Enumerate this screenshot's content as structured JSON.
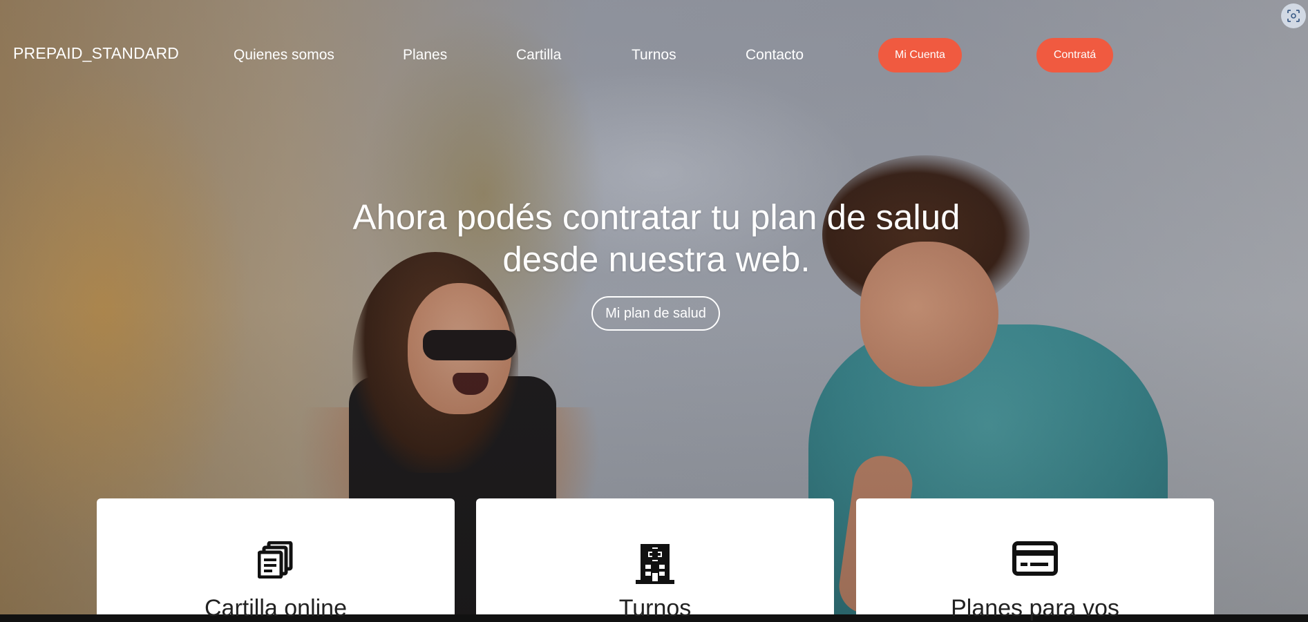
{
  "nav": {
    "brand": "PREPAID_STANDARD",
    "links": [
      "Quienes somos",
      "Planes",
      "Cartilla",
      "Turnos",
      "Contacto"
    ],
    "account_button": "Mi Cuenta",
    "contract_button": "Contratá"
  },
  "hero": {
    "headline_line1": "Ahora podés contratar tu plan de salud",
    "headline_line2": "desde nuestra web.",
    "cta": "Mi plan de salud"
  },
  "cards": [
    {
      "label": "Cartilla online",
      "icon": "documents-icon"
    },
    {
      "label": "Turnos",
      "icon": "hospital-icon"
    },
    {
      "label": "Planes para vos",
      "icon": "credit-card-icon"
    }
  ],
  "colors": {
    "accent": "#f05a40",
    "card_bg": "#ffffff",
    "text_light": "#ffffff"
  }
}
